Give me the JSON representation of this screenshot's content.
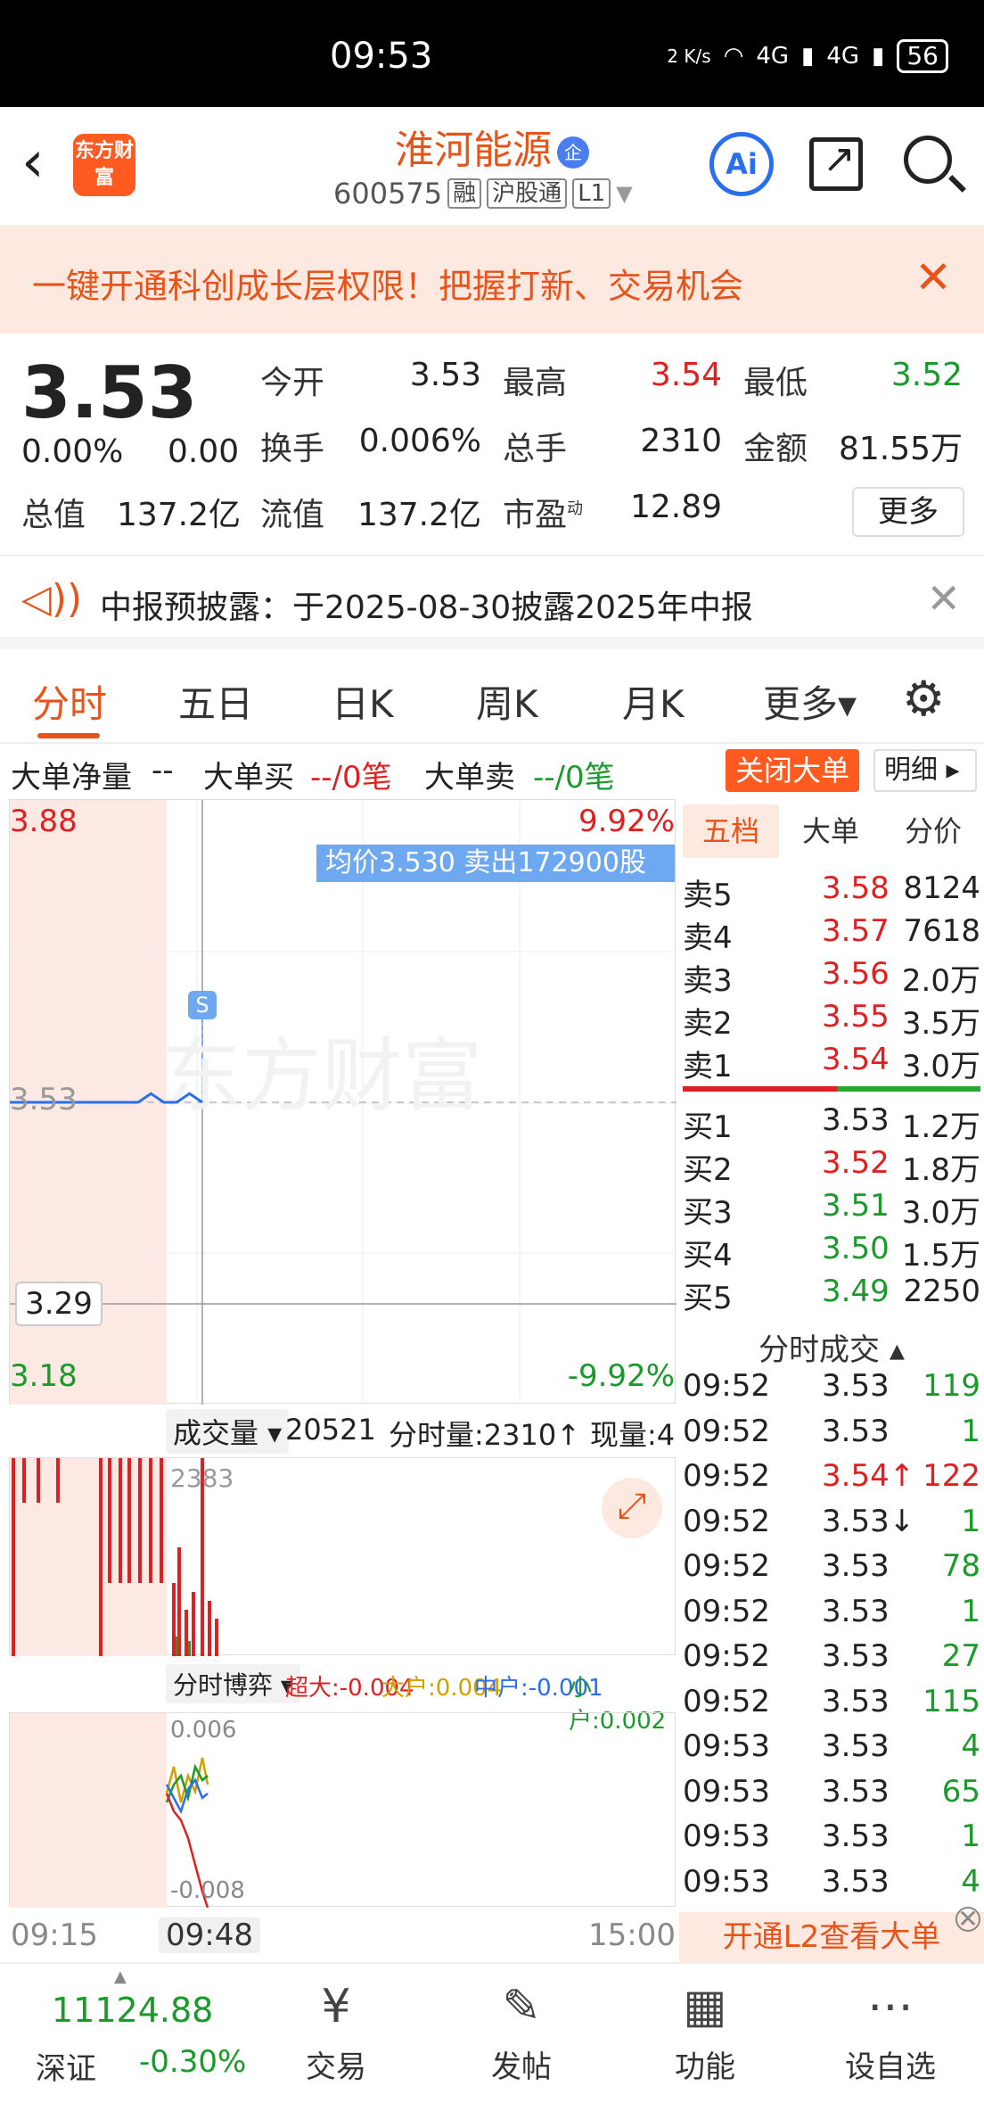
{
  "status_bar": {
    "time": "09:53",
    "net_speed": "2 K/s",
    "signal_1": "4G",
    "signal_2": "4G",
    "battery": "56"
  },
  "header": {
    "logo_text": "东方财富",
    "stock_name": "淮河能源",
    "stock_code": "600575",
    "tags": [
      "融",
      "沪股通",
      "L1"
    ],
    "ai_label": "Ai"
  },
  "promo": {
    "text": "一键开通科创成长层权限！把握打新、交易机会"
  },
  "quote": {
    "price": "3.53",
    "change_pct": "0.00%",
    "change": "0.00",
    "open_label": "今开",
    "open": "3.53",
    "high_label": "最高",
    "high": "3.54",
    "low_label": "最低",
    "low": "3.52",
    "turnover_label": "换手",
    "turnover": "0.006%",
    "volume_label": "总手",
    "volume": "2310",
    "amount_label": "金额",
    "amount": "81.55万",
    "mcap_label": "总值",
    "mcap": "137.2亿",
    "float_label": "流值",
    "float": "137.2亿",
    "pe_label": "市盈",
    "pe_sup": "动",
    "pe": "12.89",
    "more": "更多"
  },
  "notice": {
    "text": "中报预披露：于2025-08-30披露2025年中报"
  },
  "tabs": [
    "分时",
    "五日",
    "日K",
    "周K",
    "月K",
    "更多▾"
  ],
  "big_order": {
    "net_label": "大单净量",
    "net_value": "--",
    "buy_label": "大单买",
    "buy_value": "--/0笔",
    "sell_label": "大单卖",
    "sell_value": "--/0笔",
    "close_btn": "关闭大单",
    "detail_btn": "明细 ▸"
  },
  "chart_data": {
    "type": "line",
    "y_top": "3.88",
    "y_bottom": "3.18",
    "pct_top": "9.92%",
    "pct_bottom": "-9.92%",
    "prev_close": "3.53",
    "cursor_price": "3.29",
    "tooltip": "均价3.530  卖出172900股",
    "marker": "S",
    "watermark": "东方财富",
    "ylim": [
      3.18,
      3.88
    ],
    "price_series": [
      3.53,
      3.53,
      3.53,
      3.53,
      3.53,
      3.53,
      3.53,
      3.53,
      3.53,
      3.53,
      3.53,
      3.54,
      3.53,
      3.53,
      3.54,
      3.53
    ]
  },
  "volume": {
    "selector": "成交量 ▾",
    "total": "20521",
    "minute_vol": "分时量:2310↑",
    "current": "现量:4",
    "max_label": "2383"
  },
  "game": {
    "selector": "分时博弈 ▾",
    "super_large": "超大:-0.004",
    "large": "大户:0.004",
    "medium": "中户:-0.001",
    "small": "小户:0.002",
    "max_label": "0.006",
    "min_label": "-0.008"
  },
  "time_axis": {
    "start": "09:15",
    "cursor": "09:48",
    "end": "15:00"
  },
  "order_book": {
    "tabs": [
      "五档",
      "大单",
      "分价"
    ],
    "asks": [
      {
        "label": "卖5",
        "price": "3.58",
        "vol": "8124"
      },
      {
        "label": "卖4",
        "price": "3.57",
        "vol": "7618"
      },
      {
        "label": "卖3",
        "price": "3.56",
        "vol": "2.0万"
      },
      {
        "label": "卖2",
        "price": "3.55",
        "vol": "3.5万"
      },
      {
        "label": "卖1",
        "price": "3.54",
        "vol": "3.0万"
      }
    ],
    "bids": [
      {
        "label": "买1",
        "price": "3.53",
        "vol": "1.2万"
      },
      {
        "label": "买2",
        "price": "3.52",
        "vol": "1.8万"
      },
      {
        "label": "买3",
        "price": "3.51",
        "vol": "3.0万"
      },
      {
        "label": "买4",
        "price": "3.50",
        "vol": "1.5万"
      },
      {
        "label": "买5",
        "price": "3.49",
        "vol": "2250"
      }
    ],
    "trades_title": "分时成交 ▴",
    "trades": [
      {
        "time": "09:52",
        "price": "3.53",
        "vol": "119"
      },
      {
        "time": "09:52",
        "price": "3.53",
        "vol": "1"
      },
      {
        "time": "09:52",
        "price": "3.54↑",
        "vol": "122"
      },
      {
        "time": "09:52",
        "price": "3.53↓",
        "vol": "1"
      },
      {
        "time": "09:52",
        "price": "3.53",
        "vol": "78"
      },
      {
        "time": "09:52",
        "price": "3.53",
        "vol": "1"
      },
      {
        "time": "09:52",
        "price": "3.53",
        "vol": "27"
      },
      {
        "time": "09:52",
        "price": "3.53",
        "vol": "115"
      },
      {
        "time": "09:53",
        "price": "3.53",
        "vol": "4"
      },
      {
        "time": "09:53",
        "price": "3.53",
        "vol": "65"
      },
      {
        "time": "09:53",
        "price": "3.53",
        "vol": "1"
      },
      {
        "time": "09:53",
        "price": "3.53",
        "vol": "4"
      }
    ],
    "l2_banner": "开通L2查看大单"
  },
  "bottom_nav": {
    "index_value": "11124.88",
    "index_name": "深证",
    "index_change": "-0.30%",
    "items": [
      {
        "label": "交易",
        "icon": "yen-cycle-icon"
      },
      {
        "label": "发帖",
        "icon": "edit-icon"
      },
      {
        "label": "功能",
        "icon": "grid-icon"
      },
      {
        "label": "设自选",
        "icon": "more-dots-icon"
      }
    ]
  }
}
